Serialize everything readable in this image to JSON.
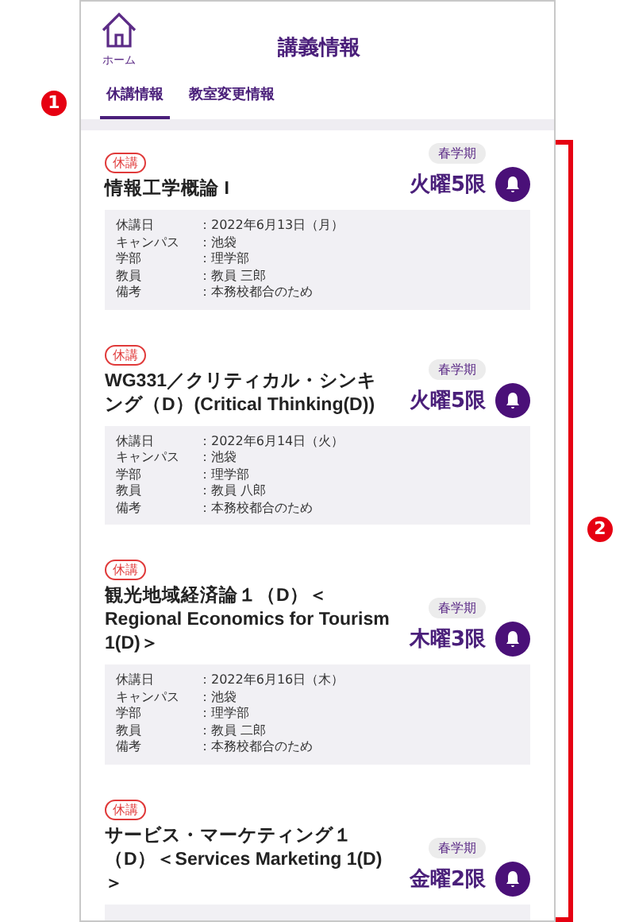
{
  "header": {
    "home_label": "ホーム",
    "title": "講義情報"
  },
  "tabs": [
    {
      "label": "休講情報",
      "selected": true
    },
    {
      "label": "教室変更情報",
      "selected": false
    }
  ],
  "callouts": {
    "tabs_marker": "1",
    "list_marker": "2"
  },
  "cards": [
    {
      "tag": "休講",
      "title": "情報工学概論 I",
      "term": "春学期",
      "period": "火曜5限",
      "details": [
        {
          "label": "休講日",
          "value": "：2022年6月13日（月）"
        },
        {
          "label": "キャンパス",
          "value": "：池袋"
        },
        {
          "label": "学部",
          "value": "：理学部"
        },
        {
          "label": "教員",
          "value": "：教員 三郎"
        },
        {
          "label": "備考",
          "value": "：本務校都合のため"
        }
      ]
    },
    {
      "tag": "休講",
      "title": "WG331／クリティカル・シンキング（D）(Critical Thinking(D))",
      "term": "春学期",
      "period": "火曜5限",
      "details": [
        {
          "label": "休講日",
          "value": "：2022年6月14日（火）"
        },
        {
          "label": "キャンパス",
          "value": "：池袋"
        },
        {
          "label": "学部",
          "value": "：理学部"
        },
        {
          "label": "教員",
          "value": "：教員 八郎"
        },
        {
          "label": "備考",
          "value": "：本務校都合のため"
        }
      ]
    },
    {
      "tag": "休講",
      "title": "観光地域経済論１（D）＜Regional Economics for Tourism 1(D)＞",
      "term": "春学期",
      "period": "木曜3限",
      "details": [
        {
          "label": "休講日",
          "value": "：2022年6月16日（木）"
        },
        {
          "label": "キャンパス",
          "value": "：池袋"
        },
        {
          "label": "学部",
          "value": "：理学部"
        },
        {
          "label": "教員",
          "value": "：教員 二郎"
        },
        {
          "label": "備考",
          "value": "：本務校都合のため"
        }
      ]
    },
    {
      "tag": "休講",
      "title": "サービス・マーケティング１（D）＜Services Marketing 1(D)＞",
      "term": "春学期",
      "period": "金曜2限"
    }
  ]
}
